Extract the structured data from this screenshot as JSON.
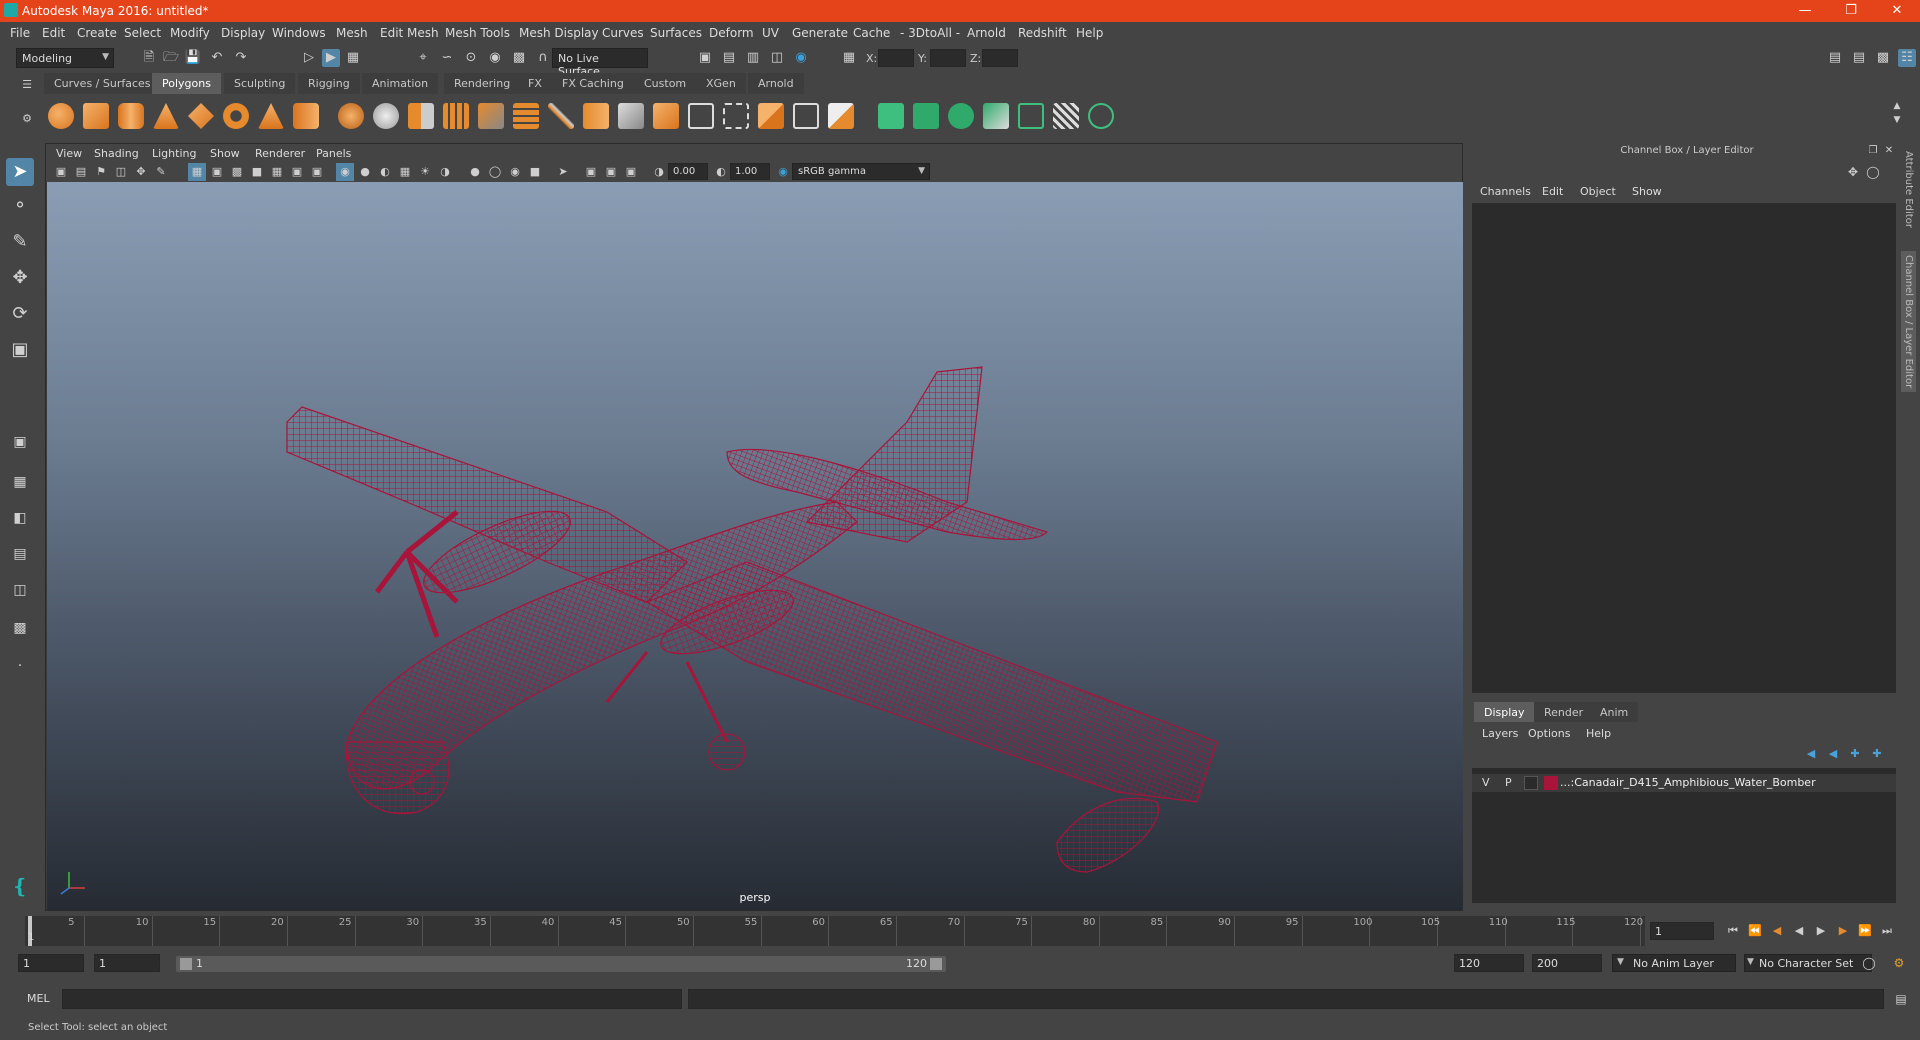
{
  "window": {
    "title": "Autodesk Maya 2016: untitled*",
    "minimize_icon": "minimize-icon",
    "restore_icon": "restore-icon",
    "close_icon": "close-icon"
  },
  "menubar": [
    "File",
    "Edit",
    "Create",
    "Select",
    "Modify",
    "Display",
    "Windows",
    "Mesh",
    "Edit Mesh",
    "Mesh Tools",
    "Mesh Display",
    "Curves",
    "Surfaces",
    "Deform",
    "UV",
    "Generate",
    "Cache",
    "- 3DtoAll -",
    "Arnold",
    "Redshift",
    "Help"
  ],
  "statusline": {
    "mode": "Modeling",
    "live_surface": "No Live Surface",
    "x_label": "X:",
    "y_label": "Y:",
    "z_label": "Z:"
  },
  "shelf": {
    "tabs": [
      "Curves / Surfaces",
      "Polygons",
      "Sculpting",
      "Rigging",
      "Animation",
      "Rendering",
      "FX",
      "FX Caching",
      "Custom",
      "XGen",
      "Arnold"
    ],
    "active_tab": "Polygons"
  },
  "viewport": {
    "menu": [
      "View",
      "Shading",
      "Lighting",
      "Show",
      "Renderer",
      "Panels"
    ],
    "exposure": "0.00",
    "gamma": "1.00",
    "color_space": "sRGB gamma",
    "camera": "persp",
    "wire_color": "#a8143a"
  },
  "channelbox": {
    "title": "Channel Box / Layer Editor",
    "menu": [
      "Channels",
      "Edit",
      "Object",
      "Show"
    ],
    "layer_tabs": [
      "Display",
      "Render",
      "Anim"
    ],
    "active_layer_tab": "Display",
    "layer_menu": [
      "Layers",
      "Options",
      "Help"
    ],
    "layer": {
      "visible": "V",
      "playback": "P",
      "name": "...:Canadair_D415_Amphibious_Water_Bomber",
      "color": "#a8143a"
    }
  },
  "sidetabs": [
    "Attribute Editor",
    "Channel Box / Layer Editor"
  ],
  "timeslider": {
    "ticks": [
      "5",
      "10",
      "15",
      "20",
      "25",
      "30",
      "35",
      "40",
      "45",
      "50",
      "55",
      "60",
      "65",
      "70",
      "75",
      "80",
      "85",
      "90",
      "95",
      "100",
      "105",
      "110",
      "115",
      "120"
    ],
    "first_frame": "1",
    "current_frame": "1"
  },
  "range": {
    "start": "1",
    "playback_start": "1",
    "slider_start": "1",
    "slider_end": "120",
    "playback_end": "120",
    "end": "200",
    "anim_layer": "No Anim Layer",
    "character_set": "No Character Set"
  },
  "cmdline": {
    "label": "MEL",
    "help": "Select Tool: select an object"
  }
}
